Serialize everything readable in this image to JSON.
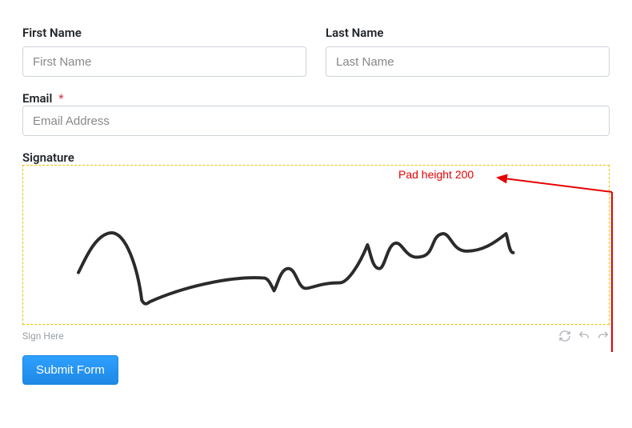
{
  "form": {
    "first_name": {
      "label": "First Name",
      "placeholder": "First Name",
      "value": ""
    },
    "last_name": {
      "label": "Last Name",
      "placeholder": "Last Name",
      "value": ""
    },
    "email": {
      "label": "Email",
      "required_mark": "*",
      "placeholder": "Email Address",
      "value": ""
    },
    "signature": {
      "label": "Signature",
      "sign_here": "Sign Here"
    },
    "submit_label": "Submit Form"
  },
  "annotation": {
    "pad_height_text": "Pad height 200"
  },
  "icons": {
    "refresh": "refresh-icon",
    "undo": "undo-icon",
    "redo": "redo-icon"
  }
}
